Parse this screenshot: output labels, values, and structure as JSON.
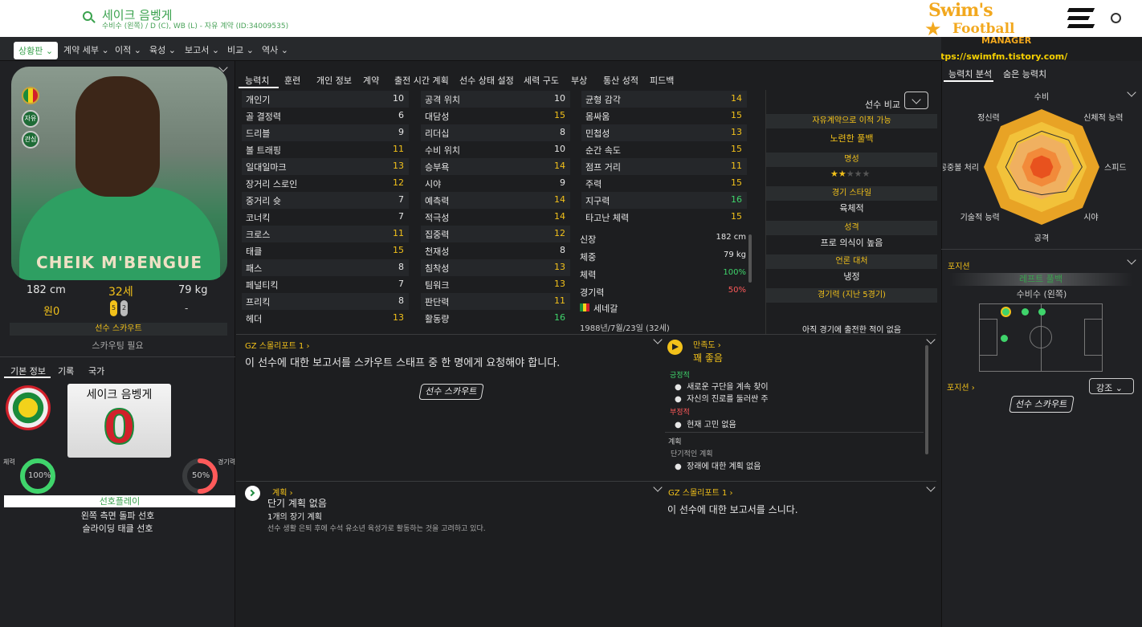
{
  "header": {
    "name": "세이크 음벵게",
    "subtitle": "수비수 (왼쪽) / D (C), WB (L) - 자유 계약 (ID:34009535)"
  },
  "logo": {
    "line1": "Swim's",
    "line2": "Football",
    "line3": "MANAGER",
    "url": "https://swimfm.tistory.com/"
  },
  "nav": {
    "active": "상황판",
    "items": [
      "계약 세부",
      "이적",
      "육성",
      "보고서",
      "비교",
      "역사"
    ]
  },
  "player": {
    "shirt_name": "CHEIK M'BENGUE",
    "height": "182 cm",
    "age": "32세",
    "weight": "79 kg",
    "value": "원0",
    "wage": "-",
    "foot_left": "5",
    "foot_right": "2",
    "badge_free": "자유",
    "badge_status": "관심",
    "scout_title": "선수 스카우트",
    "scout_need": "스카우팅 필요"
  },
  "left_tabs": [
    "기본 정보",
    "기록",
    "국가"
  ],
  "card": {
    "name": "세이크 음벵게",
    "number": "0"
  },
  "gauges": {
    "condition_label": "체력",
    "condition": "100%",
    "condition_value": 100,
    "match_label": "경기력",
    "match": "50%",
    "match_value": 50
  },
  "preferred": {
    "title": "선호플레이",
    "items": [
      "왼쪽 측면 돌파 선호",
      "슬라이딩 태클 선호"
    ]
  },
  "center_tabs": [
    "능력치",
    "훈련",
    "개인 정보",
    "계약",
    "출전 시간 계획",
    "선수 상태 설정",
    "세력 구도",
    "부상",
    "통산 성적",
    "피드백"
  ],
  "attrs_col1": [
    [
      "개인기",
      "10"
    ],
    [
      "골 결정력",
      "6"
    ],
    [
      "드리블",
      "9"
    ],
    [
      "볼 트래핑",
      "11"
    ],
    [
      "일대일마크",
      "13"
    ],
    [
      "장거리 스로인",
      "12"
    ],
    [
      "중거리 슛",
      "7"
    ],
    [
      "코너킥",
      "7"
    ],
    [
      "크로스",
      "11"
    ],
    [
      "태클",
      "15"
    ],
    [
      "패스",
      "8"
    ],
    [
      "페널티킥",
      "7"
    ],
    [
      "프리킥",
      "8"
    ],
    [
      "헤더",
      "13"
    ]
  ],
  "attrs_col2": [
    [
      "공격 위치",
      "10"
    ],
    [
      "대담성",
      "15"
    ],
    [
      "리더십",
      "8"
    ],
    [
      "수비 위치",
      "10"
    ],
    [
      "승부욕",
      "14"
    ],
    [
      "시야",
      "9"
    ],
    [
      "예측력",
      "14"
    ],
    [
      "적극성",
      "14"
    ],
    [
      "집중력",
      "12"
    ],
    [
      "천재성",
      "8"
    ],
    [
      "침착성",
      "13"
    ],
    [
      "팀워크",
      "13"
    ],
    [
      "판단력",
      "11"
    ],
    [
      "활동량",
      "16"
    ]
  ],
  "attrs_col3": [
    [
      "균형 감각",
      "14"
    ],
    [
      "몸싸움",
      "15"
    ],
    [
      "민첩성",
      "13"
    ],
    [
      "순간 속도",
      "15"
    ],
    [
      "점프 거리",
      "11"
    ],
    [
      "주력",
      "15"
    ],
    [
      "지구력",
      "16"
    ],
    [
      "타고난 체력",
      "15"
    ]
  ],
  "bio": {
    "rows": [
      [
        "신장",
        "182 cm"
      ],
      [
        "체중",
        "79 kg"
      ],
      [
        "체력",
        "100%"
      ],
      [
        "경기력",
        "50%"
      ]
    ],
    "nation": "세네갈",
    "dob": "1988년/7월/23일 (32세)"
  },
  "info": {
    "compare": "선수 비교",
    "transfer_title": "자유계약으로 이적 가능",
    "transfer_value": "노련한 풀백",
    "rep_title": "명성",
    "rep_stars": 2,
    "rep_max": 5,
    "style_title": "경기 스타일",
    "style_value": "육체적",
    "pers_title": "성격",
    "pers_value": "프로 의식이 높음",
    "media_title": "언론 대처",
    "media_value": "냉정",
    "form_title": "경기력 (지난 5경기)",
    "form_value": "아직 경기에 출전한 적이 없음"
  },
  "scout_report": {
    "title": "GZ 스몰리포트 1",
    "text": "이 선수에 대한 보고서를 스카우트 스태프 중 한 명에게 요청해야 합니다.",
    "button": "선수 스카우트"
  },
  "satisfaction": {
    "title": "만족도",
    "value": "꽤 좋음",
    "pos_title": "긍정적",
    "pos": [
      "새로운 구단을 계속 찾이",
      "자신의 진로를 둘러싼 주"
    ],
    "neg_title": "부정적",
    "neg": [
      "현재 고민 없음"
    ],
    "plan_title": "계획",
    "plan_sub": "단기적인 계획",
    "plan_items": [
      "장래에 대한 계획 없음"
    ]
  },
  "plan_panel": {
    "title": "계획",
    "short": "단기 계획 없음",
    "long": "1개의 장기 계획",
    "desc": "선수 생활 은퇴 후에 수석 유소년 육성가로 활동하는 것을 고려하고 있다."
  },
  "report2": {
    "title": "GZ 스몰리포트 1",
    "text": "이 선수에 대한 보고서를 스니다."
  },
  "right_tabs": [
    "능력치 분석",
    "숨은 능력치"
  ],
  "radar": {
    "labels": [
      "수비",
      "신체적 능력",
      "스피드",
      "시야",
      "공격",
      "기술적 능력",
      "공중볼 처리",
      "정신력"
    ],
    "values": [
      0.62,
      0.66,
      0.7,
      0.6,
      0.48,
      0.55,
      0.62,
      0.6
    ]
  },
  "position": {
    "title": "포지션",
    "role": "레프트 풀백",
    "role_sub": "수비수 (왼쪽)",
    "link": "포지션",
    "emph": "강조",
    "button": "선수 스카우트"
  },
  "colors": {
    "accent": "#3aa24e",
    "yellow": "#f2c11a",
    "green": "#3fd46b",
    "bg": "#1d1e20"
  }
}
